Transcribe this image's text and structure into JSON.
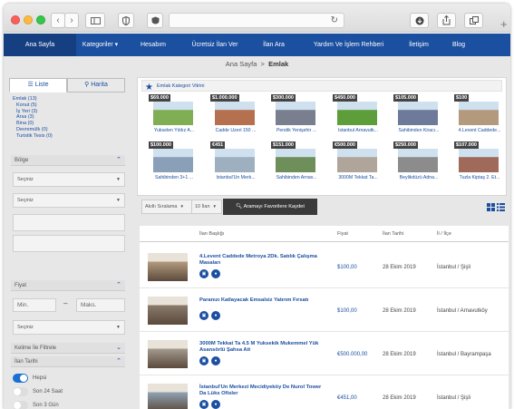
{
  "browser": {
    "url": "",
    "new_tab": "+"
  },
  "nav": {
    "items": [
      {
        "label": "Ana Sayfa"
      },
      {
        "label": "Kategoriler ▾"
      },
      {
        "label": "Hesabım"
      },
      {
        "label": "Ücretsiz İlan Ver"
      },
      {
        "label": "İlan Ara"
      },
      {
        "label": "Yardım Ve İşlem Rehberi"
      },
      {
        "label": "İletişim"
      },
      {
        "label": "Blog"
      }
    ]
  },
  "breadcrumb": {
    "home": "Ana Sayfa",
    "sep": ">",
    "current": "Emlak"
  },
  "sidebar": {
    "tabs": {
      "list": "Liste",
      "map": "Harita"
    },
    "categories": {
      "root": "Emlak (13)",
      "items": [
        "Konut (5)",
        "İş Yeri (3)",
        "Arsa (3)",
        "Bina (0)",
        "Devremülk (0)",
        "Turistik Tesis (0)"
      ]
    },
    "region_label": "Bölge",
    "region_select_1": "Seçiniz",
    "region_select_2": "Seçiniz",
    "price_label": "Fiyat",
    "price_min": "Min.",
    "price_dash": "–",
    "price_max": "Maks.",
    "currency_select": "Seçiniz",
    "keyword_label": "Kelime İle Filtrele",
    "date_label": "İlan Tarihi",
    "date_options": [
      "Hepsi",
      "Son 24 Saat",
      "Son 3 Gün"
    ]
  },
  "showcase": {
    "title": "Emlak Kategori Vitrini",
    "cards": [
      {
        "price": "$69.000",
        "title": "Yukselen Yıldız A...",
        "color": "#7fae55"
      },
      {
        "price": "$1.000.000",
        "title": "Cadde Üzeri 150 ...",
        "color": "#b5714f"
      },
      {
        "price": "$300.000",
        "title": "Pendik Yenişehir ...",
        "color": "#7a7f8f"
      },
      {
        "price": "$450.000",
        "title": "İstanbul Arnavutk...",
        "color": "#5e9e3a"
      },
      {
        "price": "$105.000",
        "title": "Sahibinden Kiracı...",
        "color": "#6e7a9a"
      },
      {
        "price": "$100",
        "title": "4.Levent Caddede...",
        "color": "#b39a7d"
      },
      {
        "price": "$100.000",
        "title": "Sahibinden 3+1 ...",
        "color": "#8aa0b8"
      },
      {
        "price": "€451",
        "title": "İstanbul'Un Merk...",
        "color": "#9eb0c0"
      },
      {
        "price": "$151.000",
        "title": "Sahibinden Arnav...",
        "color": "#6f8f5a"
      },
      {
        "price": "€500.000",
        "title": "3000M Tekkat Ta...",
        "color": "#b0a59a"
      },
      {
        "price": "$250.000",
        "title": "Beylikdüzü Adna...",
        "color": "#8c8c8c"
      },
      {
        "price": "$107.000",
        "title": "Tuzla Kiptaş 2. Et...",
        "color": "#a06a5a"
      }
    ]
  },
  "toolbar": {
    "sort": "Akıllı Sıralama",
    "per_page": "10 İlan",
    "save_search": "Aramayı Favorilere Kaydet"
  },
  "table": {
    "headers": {
      "title": "İlan Başlığı",
      "price": "Fiyat",
      "date": "İlan Tarihi",
      "location": "İl / İlçe"
    },
    "rows": [
      {
        "title": "4.Levent Caddede Metroya 2Dk. Satılık Çalışma Masaları",
        "price": "$100,00",
        "date": "28 Ekim 2019",
        "location": "İstanbul / Şişli",
        "color": "#b39a7d"
      },
      {
        "title": "Paranızı Katlayacak Emsalsiz Yatırım Fırsatı",
        "price": "$100,00",
        "date": "28 Ekim 2019",
        "location": "İstanbul / Arnavutköy",
        "color": "#8a7a6a"
      },
      {
        "title": "3000M Tekkat Ta 4.5 M Yuksekik Mukemmel Yük Asansörlü Şahsa Ait",
        "price": "€500.000,00",
        "date": "28 Ekim 2019",
        "location": "İstanbul / Bayrampaşa",
        "color": "#a39a8e"
      },
      {
        "title": "İstanbul'Un Merkezi Mecidiyeköy De Nurol Tower Da Lüks Ofisler",
        "price": "€451,00",
        "date": "28 Ekim 2019",
        "location": "İstanbul / Şişli",
        "color": "#8fa3b5"
      }
    ]
  },
  "icons": {
    "bag": "🗂",
    "pin": "⚲"
  }
}
